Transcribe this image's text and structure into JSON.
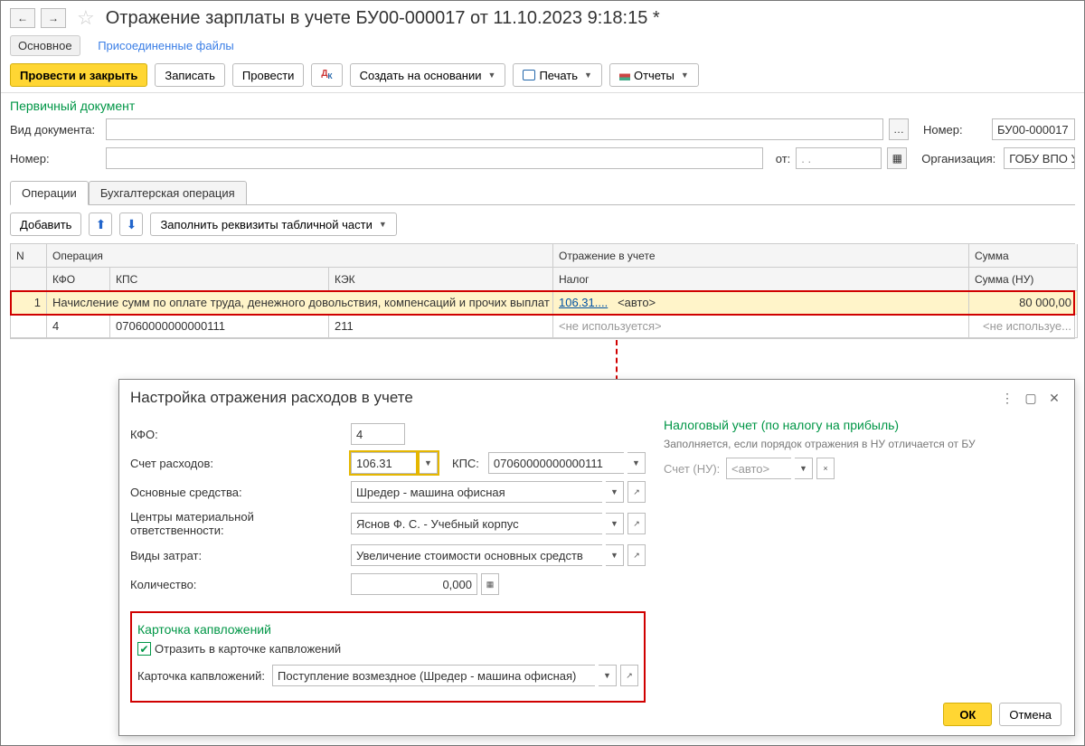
{
  "header": {
    "title": "Отражение зарплаты в учете БУ00-000017 от 11.10.2023 9:18:15 *"
  },
  "nav": {
    "main": "Основное",
    "files": "Присоединенные файлы"
  },
  "toolbar": {
    "post_close": "Провести и закрыть",
    "save": "Записать",
    "post": "Провести",
    "create_based": "Создать на основании",
    "print": "Печать",
    "reports": "Отчеты"
  },
  "section": {
    "primary_doc": "Первичный документ"
  },
  "form": {
    "doc_type_lbl": "Вид документа:",
    "doc_type_val": "",
    "number_lbl": "Номер:",
    "number_val": "БУ00-000017",
    "number2_lbl": "Номер:",
    "number2_val": "",
    "from_lbl": "от:",
    "from_val": "  .   .    ",
    "org_lbl": "Организация:",
    "org_val": "ГОБУ ВПО Университет искус"
  },
  "tabs": {
    "operations": "Операции",
    "accounting": "Бухгалтерская операция"
  },
  "subtoolbar": {
    "add": "Добавить",
    "fill": "Заполнить реквизиты табличной части"
  },
  "table": {
    "h_n": "N",
    "h_op": "Операция",
    "h_refl": "Отражение в учете",
    "h_sum": "Сумма",
    "h_kfo": "КФО",
    "h_kps": "КПС",
    "h_kek": "КЭК",
    "h_tax": "Налог",
    "h_sum_nu": "Сумма (НУ)",
    "rows": [
      {
        "n": "1",
        "op": "Начисление сумм по оплате труда, денежного довольствия, компенсаций и прочих выплат",
        "acc": "106.31....",
        "auto": "<авто>",
        "sum": "80 000,00"
      },
      {
        "kfo": "4",
        "kps": "07060000000000111",
        "kek": "211",
        "tax": "<не используется>",
        "sum_nu": "<не используе..."
      }
    ]
  },
  "popup": {
    "title": "Настройка отражения расходов в учете",
    "kfo_lbl": "КФО:",
    "kfo_val": "4",
    "acct_lbl": "Счет расходов:",
    "acct_val": "106.31",
    "kps_lbl": "КПС:",
    "kps_val": "07060000000000111",
    "os_lbl": "Основные средства:",
    "os_val": "Шредер - машина офисная",
    "cmo_lbl": "Центры материальной ответственности:",
    "cmo_val": "Яснов Ф. С. - Учебный корпус",
    "vz_lbl": "Виды затрат:",
    "vz_val": "Увеличение стоимости основных средств",
    "qty_lbl": "Количество:",
    "qty_val": "0,000",
    "card_head": "Карточка капвложений",
    "card_chk": "Отразить в карточке капвложений",
    "card_lbl": "Карточка капвложений:",
    "card_val": "Поступление возмездное (Шредер - машина офисная)",
    "tax_head": "Налоговый учет (по налогу на прибыль)",
    "tax_note": "Заполняется, если порядок отражения в НУ отличается от БУ",
    "tax_acc_lbl": "Счет (НУ):",
    "tax_acc_ph": "<авто>",
    "ok": "ОК",
    "cancel": "Отмена"
  }
}
